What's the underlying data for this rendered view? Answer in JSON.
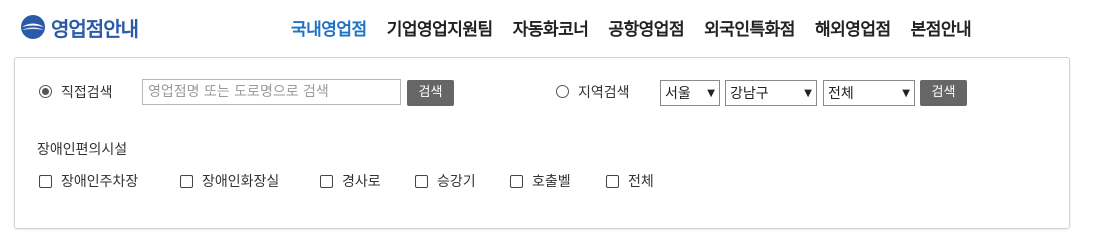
{
  "logo": {
    "text": "영업점안내"
  },
  "nav": {
    "items": [
      {
        "label": "국내영업점",
        "active": true
      },
      {
        "label": "기업영업지원팀",
        "active": false
      },
      {
        "label": "자동화코너",
        "active": false
      },
      {
        "label": "공항영업점",
        "active": false
      },
      {
        "label": "외국인특화점",
        "active": false
      },
      {
        "label": "해외영업점",
        "active": false
      },
      {
        "label": "본점안내",
        "active": false
      }
    ]
  },
  "search": {
    "direct": {
      "label": "직접검색",
      "selected": true,
      "placeholder": "영업점명 또는 도로명으로 검색",
      "value": "",
      "button": "검색"
    },
    "region": {
      "label": "지역검색",
      "selected": false,
      "city": "서울",
      "district": "강남구",
      "area": "전체",
      "button": "검색"
    }
  },
  "facilities": {
    "title": "장애인편의시설",
    "items": [
      {
        "label": "장애인주차장",
        "checked": false
      },
      {
        "label": "장애인화장실",
        "checked": false
      },
      {
        "label": "경사로",
        "checked": false
      },
      {
        "label": "승강기",
        "checked": false
      },
      {
        "label": "호출벨",
        "checked": false
      },
      {
        "label": "전체",
        "checked": false
      }
    ]
  },
  "colors": {
    "brand": "#2b5aa7",
    "nav_active": "#1f73c4",
    "button_bg": "#666666"
  }
}
